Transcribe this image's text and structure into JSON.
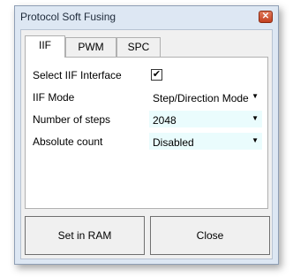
{
  "window": {
    "title": "Protocol Soft Fusing",
    "close_glyph": "✕"
  },
  "tabs": [
    {
      "label": "IIF",
      "active": true
    },
    {
      "label": "PWM",
      "active": false
    },
    {
      "label": "SPC",
      "active": false
    }
  ],
  "fields": {
    "select_iif_interface": {
      "label": "Select IIF Interface",
      "checked": true,
      "check_glyph": "✔"
    },
    "iif_mode": {
      "label": "IIF Mode",
      "value": "Step/Direction Mode"
    },
    "number_of_steps": {
      "label": "Number of steps",
      "value": "2048"
    },
    "absolute_count": {
      "label": "Absolute count",
      "value": "Disabled"
    }
  },
  "buttons": {
    "set_in_ram": "Set in RAM",
    "close": "Close"
  },
  "icons": {
    "dropdown": "chevron-down-icon",
    "close": "close-icon"
  },
  "colors": {
    "combo_bg": "#eafcfd",
    "window_bg": "#dde7f3",
    "close_red": "#c3401f"
  }
}
